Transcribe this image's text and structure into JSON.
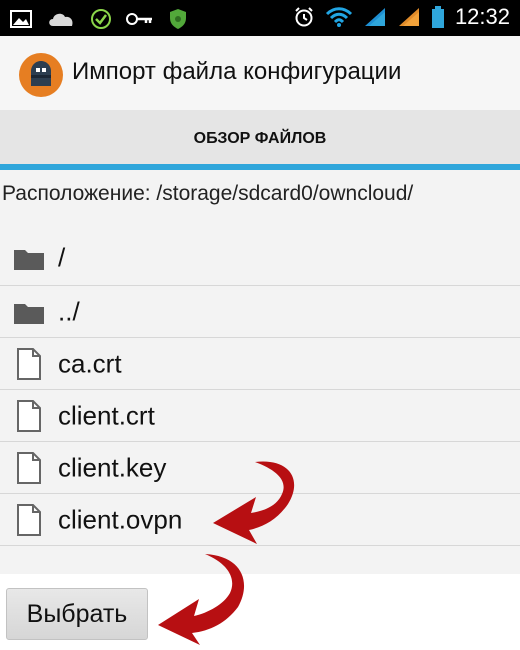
{
  "status_bar": {
    "time": "12:32",
    "icons": [
      "image-icon",
      "cloud-icon",
      "check-circle-icon",
      "key-icon",
      "shield-icon",
      "alarm-icon",
      "wifi-icon",
      "signal-icon",
      "signal-icon-2",
      "battery-icon"
    ]
  },
  "action_bar": {
    "title": "Импорт файла конфигурации"
  },
  "tabs": {
    "items": [
      {
        "label": "ОБЗОР ФАЙЛОВ"
      }
    ]
  },
  "location": {
    "text": "Расположение: /storage/sdcard0/owncloud/"
  },
  "files": [
    {
      "name": "/",
      "type": "folder"
    },
    {
      "name": "../",
      "type": "folder"
    },
    {
      "name": "ca.crt",
      "type": "file"
    },
    {
      "name": "client.crt",
      "type": "file"
    },
    {
      "name": "client.key",
      "type": "file"
    },
    {
      "name": "client.ovpn",
      "type": "file"
    }
  ],
  "actions": {
    "select_label": "Выбрать"
  },
  "colors": {
    "accent": "#2fa6db",
    "arrow": "#b70f12"
  }
}
